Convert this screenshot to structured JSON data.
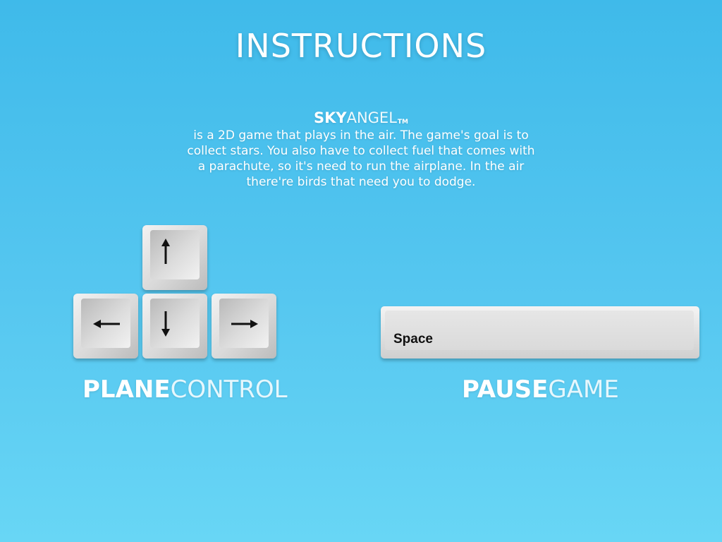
{
  "screen": {
    "title": "INSTRUCTIONS"
  },
  "brand": {
    "name_strong": "SKY",
    "name_light": "ANGEL",
    "trademark": "TM"
  },
  "description": "is a 2D game that plays in the air. The game's goal is to collect stars. You also have to collect fuel that comes with a parachute, so it's need to run the airplane. In the air there're birds that need you to dodge.",
  "controls": {
    "plane": {
      "label_strong": "PLANE",
      "label_light": "CONTROL",
      "keys": [
        "arrow-up",
        "arrow-left",
        "arrow-down",
        "arrow-right"
      ]
    },
    "pause": {
      "label_strong": "PAUSE",
      "label_light": "GAME",
      "key_label": "Space"
    }
  },
  "colors": {
    "background_top": "#3fbaea",
    "background_bottom": "#68d6f5",
    "text": "#ffffff",
    "key_label": "#111111"
  }
}
